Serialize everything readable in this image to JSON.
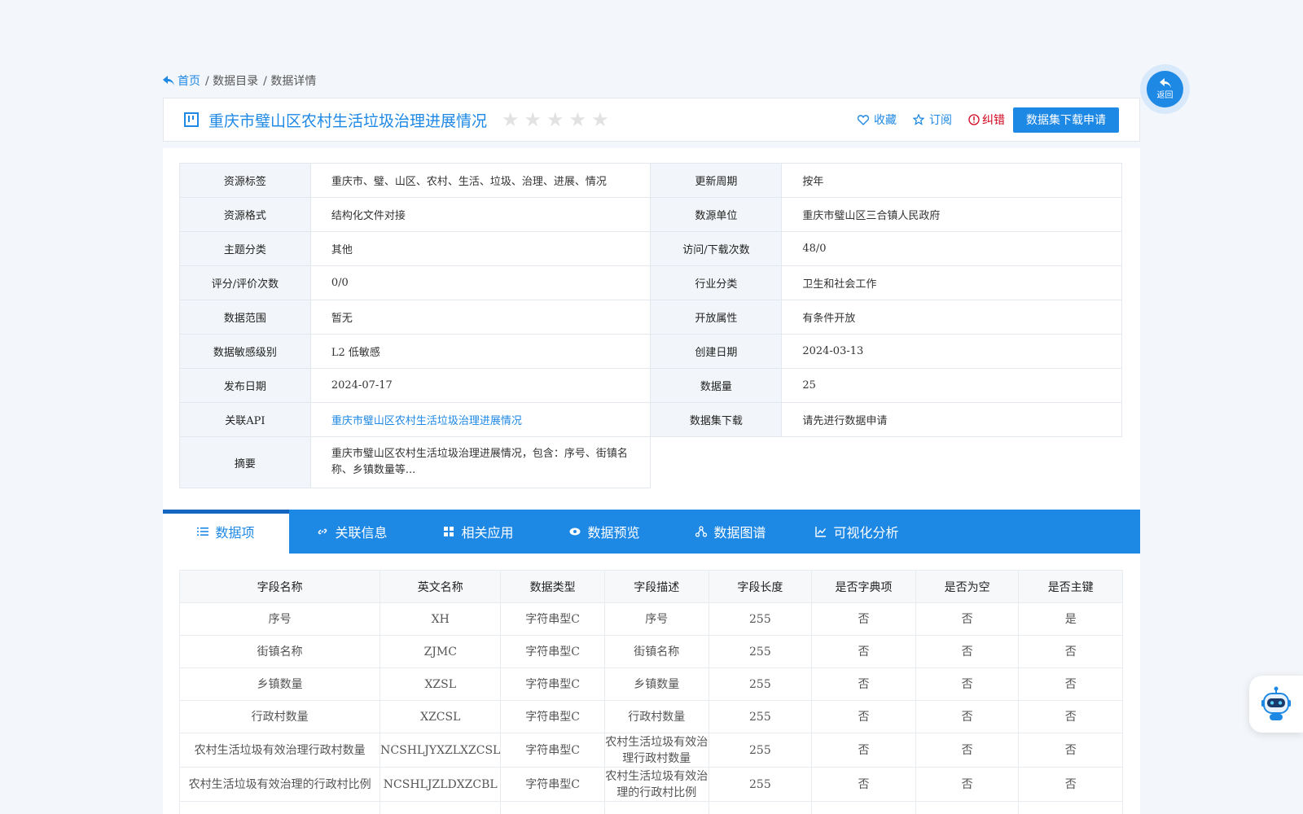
{
  "breadcrumb": {
    "home": "首页",
    "catalog": "/ 数据目录",
    "detail": "/ 数据详情"
  },
  "header": {
    "title": "重庆市璧山区农村生活垃圾治理进展情况",
    "rating_stars": 0,
    "rating_max": 5,
    "favorite": "收藏",
    "subscribe": "订阅",
    "report_error": "纠错",
    "apply_button": "数据集下载申请"
  },
  "info": {
    "tags_label": "资源标签",
    "tags": "重庆市、璧、山区、农村、生活、垃圾、治理、进展、情况",
    "cycle_label": "更新周期",
    "cycle": "按年",
    "format_label": "资源格式",
    "format": "结构化文件对接",
    "unit_label": "数源单位",
    "unit": "重庆市璧山区三合镇人民政府",
    "topic_label": "主题分类",
    "topic": "其他",
    "visits_label": "访问/下载次数",
    "visits": "48/0",
    "score_label": "评分/评价次数",
    "score": "0/0",
    "industry_label": "行业分类",
    "industry": "卫生和社会工作",
    "scope_label": "数据范围",
    "scope": "暂无",
    "open_label": "开放属性",
    "open": "有条件开放",
    "sensitivity_label": "数据敏感级别",
    "sensitivity": "L2 低敏感",
    "created_label": "创建日期",
    "created": "2024-03-13",
    "published_label": "发布日期",
    "published": "2024-07-17",
    "count_label": "数据量",
    "count": "25",
    "api_label": "关联API",
    "api": "重庆市璧山区农村生活垃圾治理进展情况",
    "download_label": "数据集下载",
    "download": "请先进行数据申请",
    "summary_label": "摘要",
    "summary": "重庆市璧山区农村生活垃圾治理进展情况，包含：序号、街镇名称、乡镇数量等..."
  },
  "tabs": [
    {
      "label": "数据项",
      "icon": "list-icon"
    },
    {
      "label": "关联信息",
      "icon": "link-icon"
    },
    {
      "label": "相关应用",
      "icon": "apps-icon"
    },
    {
      "label": "数据预览",
      "icon": "eye-icon"
    },
    {
      "label": "数据图谱",
      "icon": "graph-icon"
    },
    {
      "label": "可视化分析",
      "icon": "chart-icon"
    }
  ],
  "fields": {
    "headers": [
      "字段名称",
      "英文名称",
      "数据类型",
      "字段描述",
      "字段长度",
      "是否字典项",
      "是否为空",
      "是否主键"
    ],
    "rows": [
      [
        "序号",
        "XH",
        "字符串型C",
        "序号",
        "255",
        "否",
        "否",
        "是"
      ],
      [
        "街镇名称",
        "ZJMC",
        "字符串型C",
        "街镇名称",
        "255",
        "否",
        "否",
        "否"
      ],
      [
        "乡镇数量",
        "XZSL",
        "字符串型C",
        "乡镇数量",
        "255",
        "否",
        "否",
        "否"
      ],
      [
        "行政村数量",
        "XZCSL",
        "字符串型C",
        "行政村数量",
        "255",
        "否",
        "否",
        "否"
      ],
      [
        "农村生活垃圾有效治理行政村数量",
        "NCSHLJYXZLXZCSL",
        "字符串型C",
        "农村生活垃圾有效治理行政村数量",
        "255",
        "否",
        "否",
        "否"
      ],
      [
        "农村生活垃圾有效治理的行政村比例",
        "NCSHLJZLDXZCBL",
        "字符串型C",
        "农村生活垃圾有效治理的行政村比例",
        "255",
        "否",
        "否",
        "否"
      ]
    ]
  },
  "floating": {
    "back_label": "返回"
  },
  "colors": {
    "accent": "#1e88e5",
    "error": "#d0021b"
  }
}
